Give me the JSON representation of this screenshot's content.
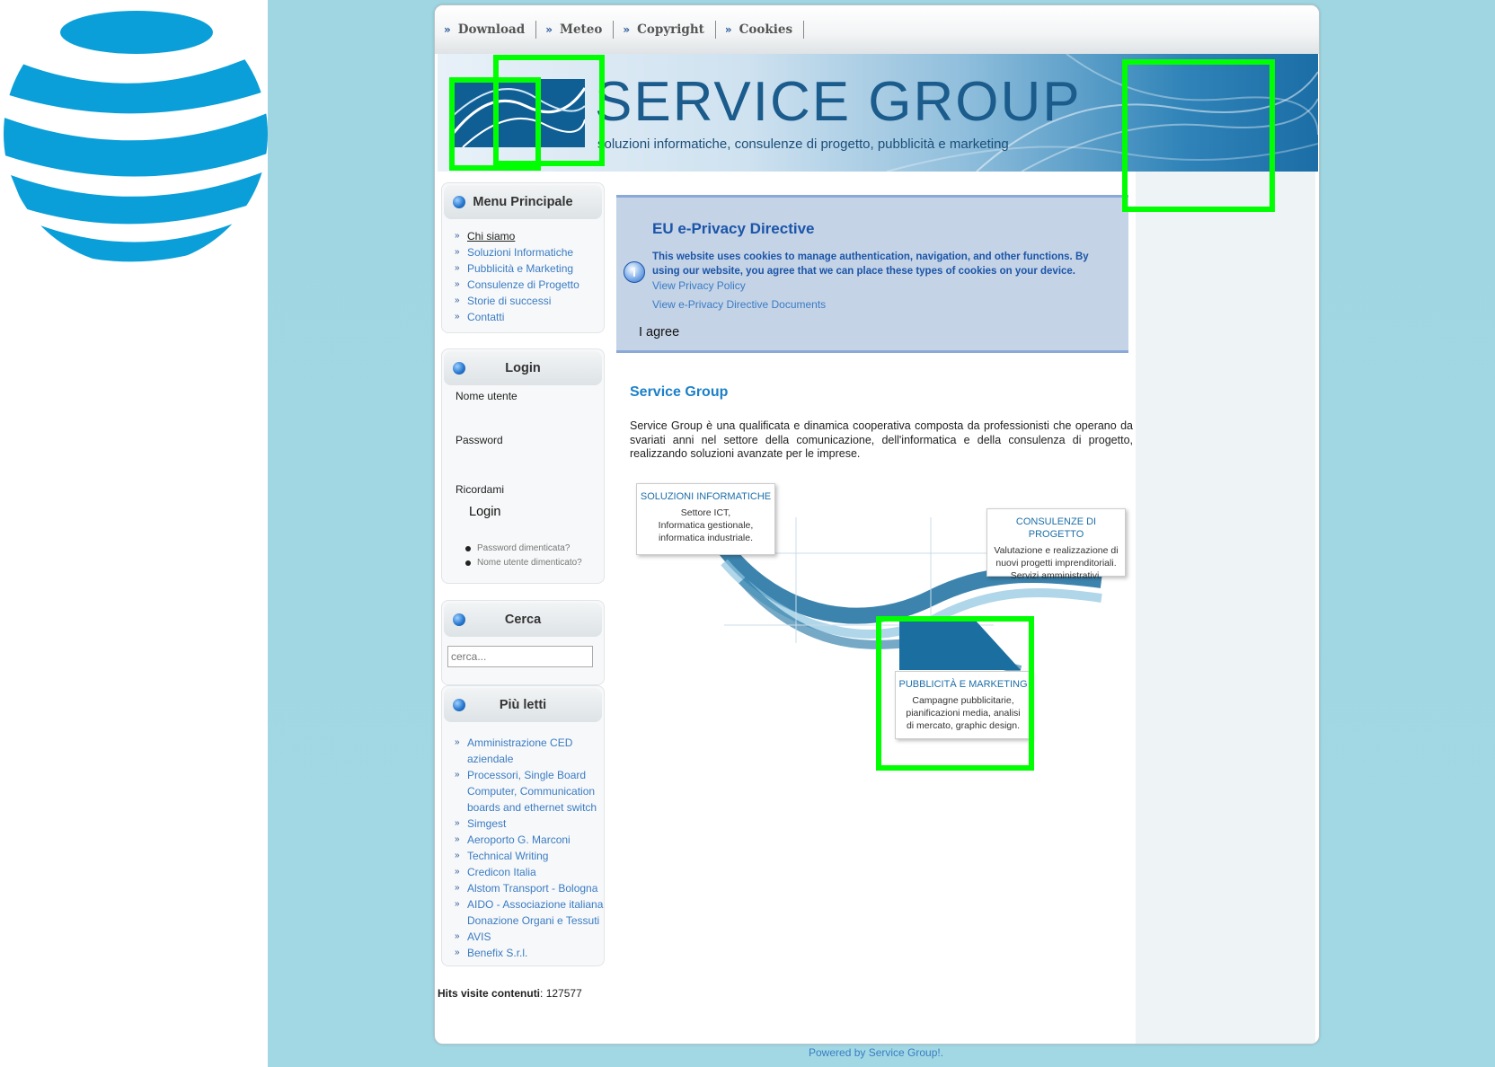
{
  "topnav": {
    "items": [
      {
        "label": "Download"
      },
      {
        "label": "Meteo"
      },
      {
        "label": "Copyright"
      },
      {
        "label": "Cookies"
      }
    ]
  },
  "banner": {
    "title": "SERVICE GROUP",
    "subtitle": "soluzioni informatiche, consulenze di progetto, pubblicità e marketing"
  },
  "menu_principale": {
    "title": "Menu Principale",
    "items": [
      {
        "label": "Chi siamo",
        "active": true
      },
      {
        "label": "Soluzioni Informatiche"
      },
      {
        "label": "Pubblicità e Marketing"
      },
      {
        "label": "Consulenze di Progetto"
      },
      {
        "label": "Storie di successi"
      },
      {
        "label": "Contatti"
      }
    ]
  },
  "login": {
    "title": "Login",
    "username_label": "Nome utente",
    "password_label": "Password",
    "remember_label": "Ricordami",
    "submit_label": "Login",
    "forgot_password": "Password dimenticata?",
    "forgot_username": "Nome utente dimenticato?"
  },
  "cerca": {
    "title": "Cerca",
    "placeholder": "cerca..."
  },
  "piu_letti": {
    "title": "Più letti",
    "items": [
      {
        "label": "Amministrazione CED aziendale"
      },
      {
        "label": "Processori, Single Board Computer, Communication boards and ethernet switch"
      },
      {
        "label": "Simgest"
      },
      {
        "label": "Aeroporto G. Marconi"
      },
      {
        "label": "Technical Writing"
      },
      {
        "label": "Credicon Italia"
      },
      {
        "label": "Alstom Transport - Bologna"
      },
      {
        "label": "AIDO - Associazione italiana Donazione Organi e Tessuti"
      },
      {
        "label": "AVIS"
      },
      {
        "label": "Benefix S.r.l."
      }
    ]
  },
  "hits": {
    "label": "Hits visite contenuti",
    "value": ": 127577"
  },
  "cookie_notice": {
    "title": "EU e-Privacy Directive",
    "text": "This website uses cookies to manage authentication, navigation, and other functions. By using our website, you agree that we can place these types of cookies on your device.",
    "link_policy": "View Privacy Policy",
    "link_docs": "View e-Privacy Directive Documents",
    "agree_label": "I agree"
  },
  "article": {
    "title": "Service Group",
    "body": "Service Group è una qualificata e dinamica cooperativa composta da professionisti che operano da svariati anni nel settore della comunicazione, dell'informatica e della consulenza di progetto, realizzando soluzioni avanzate per le imprese."
  },
  "diagram": {
    "box1": {
      "title": "SOLUZIONI INFORMATICHE",
      "lines": [
        "Settore ICT,",
        "Informatica gestionale,",
        "informatica industriale."
      ]
    },
    "box2": {
      "title": "CONSULENZE DI PROGETTO",
      "lines": [
        "Valutazione e realizzazione di",
        "nuovi progetti imprenditoriali.",
        "Servizi amministrativi."
      ]
    },
    "box3": {
      "title": "PUBBLICITÀ E MARKETING",
      "lines": [
        "Campagne pubblicitarie,",
        "pianificazioni media, analisi",
        "di mercato, graphic design."
      ]
    }
  },
  "footer": {
    "text": "Powered by Service Group!."
  },
  "colors": {
    "accent": "#3a7cc4",
    "highlight": "#00ff00",
    "cookie_bg": "#c4d3e6"
  }
}
